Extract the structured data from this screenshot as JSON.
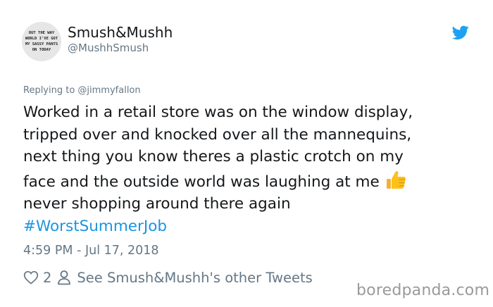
{
  "user": {
    "name": "Smush&Mushh",
    "handle": "@MushhSmush",
    "avatar_lines": [
      "OUT THE WAY",
      "WORLD I'VE GOT",
      "MY SASSY PANTS",
      "ON TODAY"
    ]
  },
  "replying_to": "Replying to @jimmyfallon",
  "tweet": {
    "lines": [
      "Worked in a retail store was on the window display,",
      "tripped over and knocked over all the mannequins,",
      "next thing you know theres a plastic crotch on my",
      "face and the outside world was laughing at me",
      "never shopping around there again"
    ],
    "hashtag": "#WorstSummerJob"
  },
  "timestamp": "4:59 PM - Jul 17, 2018",
  "footer": {
    "likes_count": "2",
    "profile_link": "See Smush&Mushh's other Tweets"
  },
  "watermark": "boredpanda.com",
  "colors": {
    "twitter_blue": "#1da1f2",
    "hashtag": "#1b95e0",
    "secondary_text": "#657786",
    "primary_text": "#14171a"
  },
  "icons": [
    "twitter-bird-icon",
    "thumbs-up-emoji-icon",
    "heart-icon",
    "person-icon"
  ]
}
